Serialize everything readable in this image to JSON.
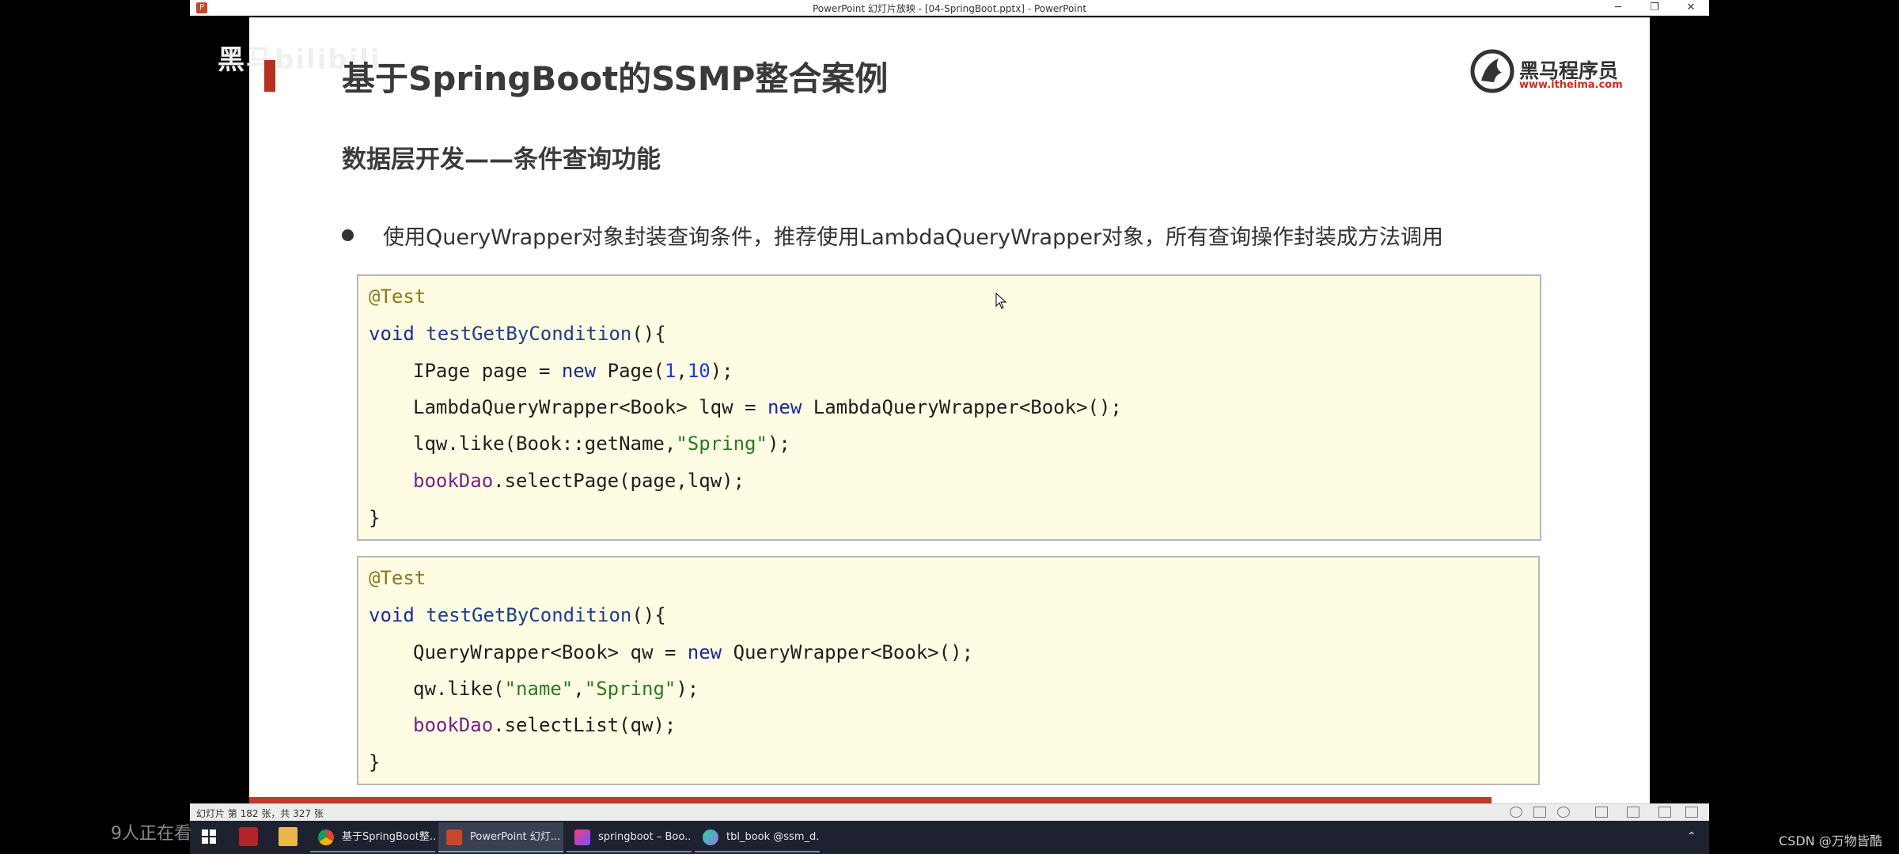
{
  "window": {
    "title": "PowerPoint 幻灯片放映 - [04-SpringBoot.pptx] - PowerPoint",
    "minimize": "─",
    "restore": "❐",
    "close": "✕"
  },
  "overlay": {
    "watermark": "黑马bilibili",
    "viewers": "9人正在看",
    "csdn": "CSDN @万物皆酷"
  },
  "slide": {
    "title": "基于SpringBoot的SSMP整合案例",
    "logo_text": "黑马程序员",
    "logo_url": "www.itheima.com",
    "subtitle": "数据层开发——条件查询功能",
    "bullet": "使用QueryWrapper对象封装查询条件，推荐使用LambdaQueryWrapper对象，所有查询操作封装成方法调用"
  },
  "status": {
    "slide_counter": "幻灯片 第 182 张，共 327 张",
    "progress": 0.887
  },
  "taskbar": {
    "items": [
      {
        "label": "基于SpringBoot整...",
        "app": "chrome"
      },
      {
        "label": "PowerPoint 幻灯...",
        "app": "powerpoint"
      },
      {
        "label": "springboot – Boo...",
        "app": "intellij"
      },
      {
        "label": "tbl_book @ssm_d...",
        "app": "datagrip"
      }
    ]
  },
  "colors": {
    "accent_red": "#c0392b",
    "code_bg": "#fefde3",
    "taskbar_bg": "#1e2230"
  }
}
